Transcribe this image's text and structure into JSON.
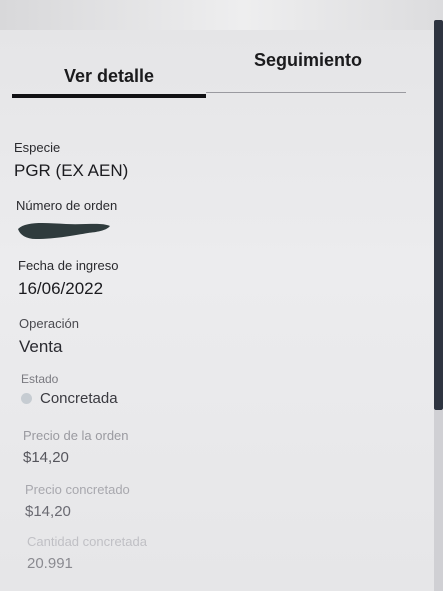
{
  "tabs": [
    {
      "label": "Ver detalle",
      "active": true
    },
    {
      "label": "Seguimiento",
      "active": false
    }
  ],
  "fields": {
    "especie": {
      "label": "Especie",
      "value": "PGR (EX AEN)"
    },
    "numero_orden": {
      "label": "Número de orden",
      "value": ""
    },
    "fecha_ingreso": {
      "label": "Fecha de ingreso",
      "value": "16/06/2022"
    },
    "operacion": {
      "label": "Operación",
      "value": "Venta"
    },
    "estado": {
      "label": "Estado",
      "value": "Concretada"
    },
    "precio_orden": {
      "label": "Precio de la orden",
      "value": "$14,20"
    },
    "precio_concretado": {
      "label": "Precio concretado",
      "value": "$14,20"
    },
    "cantidad_concretada": {
      "label": "Cantidad concretada",
      "value": "20.991"
    }
  },
  "colors": {
    "active_underline": "#111114",
    "status_dot": "#c6ccd2",
    "redaction": "#2f3b3d"
  },
  "icons": {
    "status_indicator": "status-dot-icon"
  }
}
